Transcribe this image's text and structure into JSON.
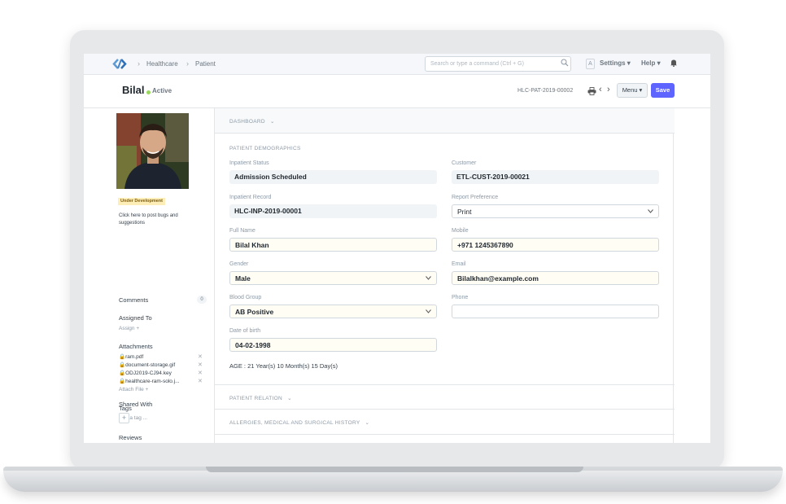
{
  "navbar": {
    "breadcrumbs": [
      "Healthcare",
      "Patient"
    ],
    "search_placeholder": "Search or type a command (Ctrl + G)",
    "avatar_letter": "A",
    "settings_label": "Settings",
    "help_label": "Help"
  },
  "doc": {
    "title": "Bilal",
    "status": "Active",
    "id": "HLC-PAT-2019-00002",
    "menu_label": "Menu",
    "save_label": "Save"
  },
  "sidebar": {
    "badge": "Under Development",
    "bug_text": "Click here to post bugs and suggestions",
    "comments_label": "Comments",
    "comments_count": "0",
    "assigned_to_label": "Assigned To",
    "assign_link": "Assign",
    "attachments_label": "Attachments",
    "attachments": [
      "ram.pdf",
      "document-storage.gif",
      "ODJ2019-CJ94.key",
      "healthcare-ram-solo.j..."
    ],
    "attach_file_link": "Attach File",
    "tags_label": "Tags",
    "add_tag_link": "Add a tag ...",
    "reviews_label": "Reviews",
    "shared_with_label": "Shared With"
  },
  "main": {
    "dashboard_label": "DASHBOARD",
    "demographics_label": "PATIENT DEMOGRAPHICS",
    "fields": {
      "inpatient_status": {
        "label": "Inpatient Status",
        "value": "Admission Scheduled"
      },
      "customer": {
        "label": "Customer",
        "value": "ETL-CUST-2019-00021"
      },
      "inpatient_record": {
        "label": "Inpatient Record",
        "value": "HLC-INP-2019-00001"
      },
      "report_preference": {
        "label": "Report Preference",
        "value": "Print"
      },
      "full_name": {
        "label": "Full Name",
        "value": "Bilal Khan"
      },
      "mobile": {
        "label": "Mobile",
        "value": "+971 1245367890"
      },
      "gender": {
        "label": "Gender",
        "value": "Male"
      },
      "email": {
        "label": "Email",
        "value": "Bilalkhan@example.com"
      },
      "blood_group": {
        "label": "Blood Group",
        "value": "AB Positive"
      },
      "phone": {
        "label": "Phone",
        "value": ""
      },
      "dob": {
        "label": "Date of birth",
        "value": "04-02-1998"
      }
    },
    "age_text": "AGE : 21 Year(s) 10 Month(s) 15 Day(s)",
    "patient_relation_label": "PATIENT RELATION",
    "allergies_label": "ALLERGIES, MEDICAL AND SURGICAL HISTORY"
  },
  "colors": {
    "accent": "#5e64ff",
    "status_green": "#98d85b"
  }
}
